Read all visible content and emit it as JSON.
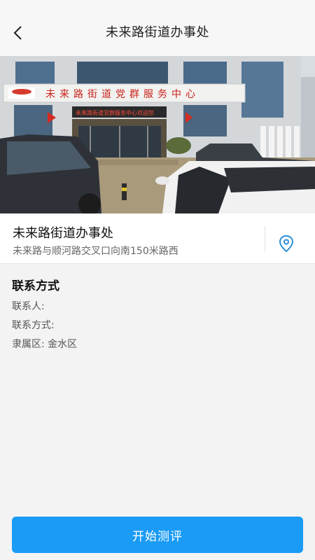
{
  "navbar": {
    "title": "未来路街道办事处",
    "back_icon": "chevron-left-icon"
  },
  "hero": {
    "banner_text": "未来路街道党群服务中心",
    "led_text": "未来路街道党群服务中心欢迎您"
  },
  "place": {
    "name": "未来路街道办事处",
    "address": "未来路与顺河路交叉口向南150米路西",
    "location_icon": "location-pin-icon"
  },
  "contact": {
    "heading": "联系方式",
    "person": "联系人:",
    "phone": "联系方式:",
    "district": "隶属区: 金水区"
  },
  "actions": {
    "start_label": "开始测评"
  },
  "colors": {
    "accent": "#1a9bf5",
    "pin": "#2a8fd9"
  }
}
